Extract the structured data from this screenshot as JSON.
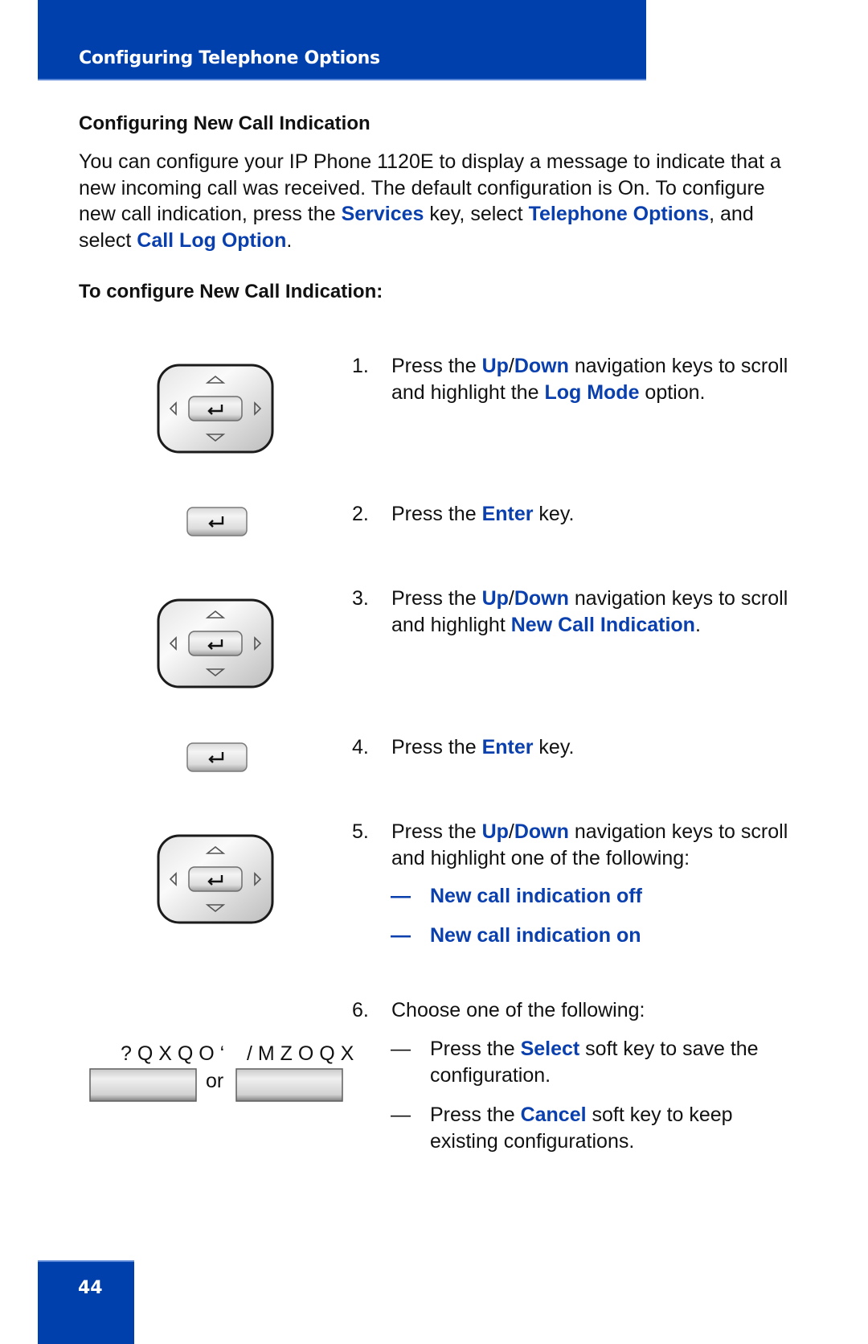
{
  "header": {
    "title": "Configuring Telephone Options"
  },
  "section": {
    "title": "Configuring New Call Indication",
    "intro": [
      {
        "t": "You can configure your IP Phone 1120E to display a message to indicate that a new incoming call was received. The default configuration is On. To configure new call indication, press the "
      },
      {
        "t": "Services",
        "hl": true
      },
      {
        "t": " key, select "
      },
      {
        "t": "Telephone Options",
        "hl": true
      },
      {
        "t": ", and select "
      },
      {
        "t": "Call Log Option",
        "hl": true
      },
      {
        "t": "."
      }
    ],
    "procedure_title": "To configure New Call Indication:"
  },
  "steps": [
    {
      "num": "1.",
      "parts": [
        {
          "t": "Press the "
        },
        {
          "t": "Up",
          "hl": true
        },
        {
          "t": "/"
        },
        {
          "t": "Down",
          "hl": true
        },
        {
          "t": " navigation keys to scroll and highlight the "
        },
        {
          "t": "Log Mode",
          "hl": true
        },
        {
          "t": " option."
        }
      ]
    },
    {
      "num": "2.",
      "parts": [
        {
          "t": "Press the "
        },
        {
          "t": "Enter",
          "hl": true
        },
        {
          "t": " key."
        }
      ]
    },
    {
      "num": "3.",
      "parts": [
        {
          "t": "Press the "
        },
        {
          "t": "Up",
          "hl": true
        },
        {
          "t": "/"
        },
        {
          "t": "Down",
          "hl": true
        },
        {
          "t": " navigation keys to scroll and highlight "
        },
        {
          "t": "New Call Indication",
          "hl": true
        },
        {
          "t": "."
        }
      ]
    },
    {
      "num": "4.",
      "parts": [
        {
          "t": "Press the "
        },
        {
          "t": "Enter",
          "hl": true
        },
        {
          "t": " key."
        }
      ]
    },
    {
      "num": "5.",
      "parts": [
        {
          "t": "Press the "
        },
        {
          "t": "Up",
          "hl": true
        },
        {
          "t": "/"
        },
        {
          "t": "Down",
          "hl": true
        },
        {
          "t": " navigation keys to scroll and highlight one of the following:"
        }
      ]
    },
    {
      "num": "6.",
      "parts": [
        {
          "t": "Choose one of the following:"
        }
      ]
    }
  ],
  "step5_options": [
    {
      "dash": "—",
      "parts": [
        {
          "t": "New call indication off",
          "hl": true
        }
      ]
    },
    {
      "dash": "—",
      "parts": [
        {
          "t": "New call indication on",
          "hl": true
        }
      ]
    }
  ],
  "step6_options": [
    {
      "dash": "—",
      "parts": [
        {
          "t": "Press the "
        },
        {
          "t": "Select",
          "hl": true
        },
        {
          "t": " soft key to save the configuration."
        }
      ]
    },
    {
      "dash": "—",
      "parts": [
        {
          "t": "Press the "
        },
        {
          "t": "Cancel",
          "hl": true
        },
        {
          "t": " soft key to keep existing configurations."
        }
      ]
    }
  ],
  "softkeys": {
    "labels": "? Q X Q O ‘    / M Z O Q X",
    "or": "or"
  },
  "icons": {
    "navpad": "navigation-cluster-icon",
    "enter": "enter-key-icon",
    "softkey": "soft-key-icon"
  },
  "footer": {
    "page_number": "44"
  },
  "colors": {
    "brand_blue": "#0040ad",
    "highlight_blue": "#0a3fae"
  }
}
